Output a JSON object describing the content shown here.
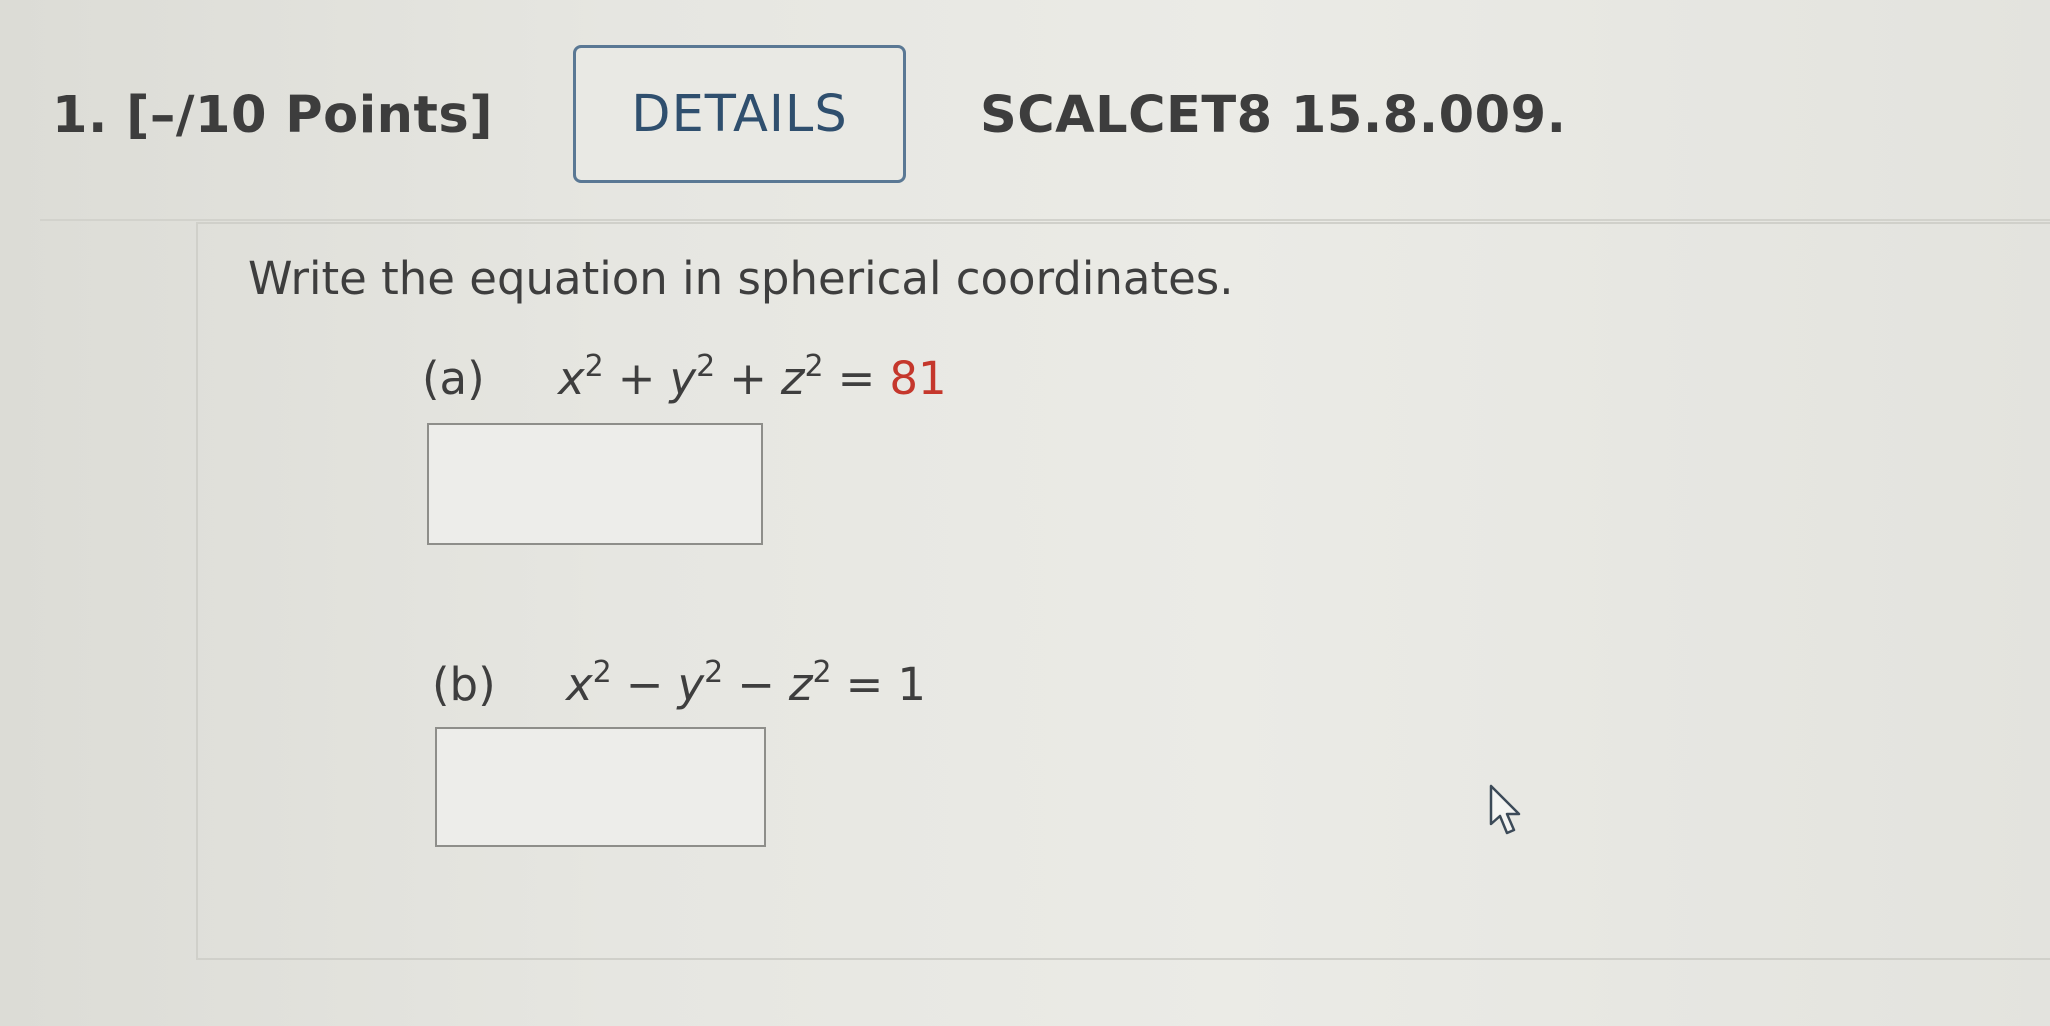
{
  "question": {
    "number_points": "1. [–/10 Points]",
    "details_label": "DETAILS",
    "code": "SCALCET8 15.8.009."
  },
  "instruction": "Write the equation in spherical coordinates.",
  "parts": [
    {
      "label": "(a)",
      "terms": [
        "x",
        "y",
        "z"
      ],
      "exponent": "2",
      "ops": [
        "+",
        "+"
      ],
      "equals": "=",
      "rhs": "81",
      "answer": ""
    },
    {
      "label": "(b)",
      "terms": [
        "x",
        "y",
        "z"
      ],
      "exponent": "2",
      "ops": [
        "−",
        "−"
      ],
      "equals": "=",
      "rhs": "1",
      "answer": ""
    }
  ],
  "colors": {
    "rhs_highlight": "#c5372c",
    "details_border": "#5a7894"
  },
  "icons": {
    "pointer": "mouse-pointer-icon"
  }
}
